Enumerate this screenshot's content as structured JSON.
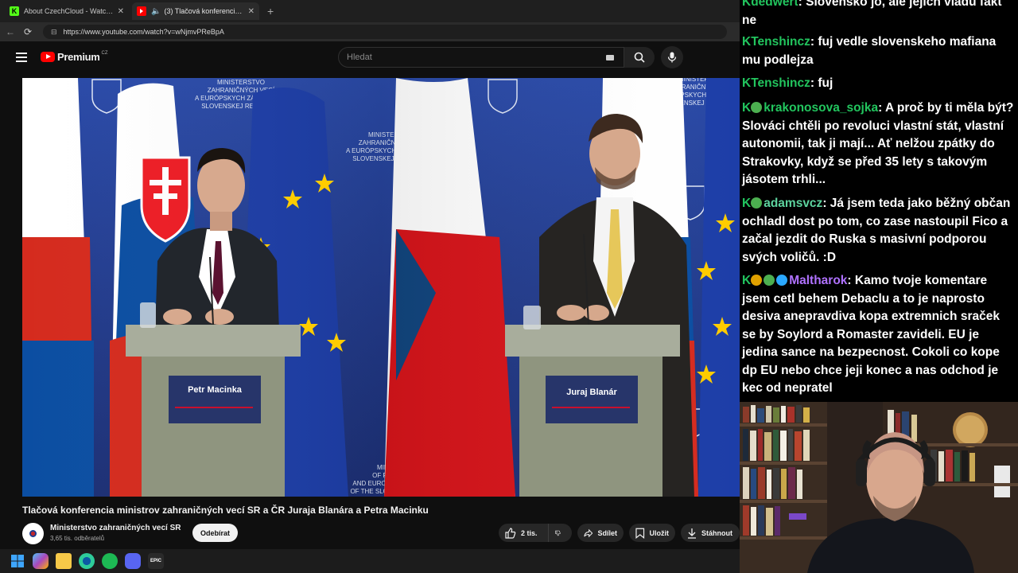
{
  "browser": {
    "tabs": [
      {
        "title": "About CzechCloud - Watch Live o",
        "close": "✕"
      },
      {
        "title": "(3) Tlačová konferencia minist",
        "close": "✕"
      }
    ],
    "new_tab": "+",
    "url": "https://www.youtube.com/watch?v=wNjmvPReBpA"
  },
  "youtube": {
    "logo": "Premium",
    "country": "CZ",
    "search_placeholder": "Hledat",
    "video": {
      "left_name": "Petr Macinka",
      "right_name": "Juraj Blanár",
      "ministry_text": [
        "MINISTERSTVO",
        "ZAHRANIČNÝCH VECÍ",
        "A EURÓPSKYCH ZÁLEŽITOSTÍ",
        "SLOVENSKEJ REPUBLIKY"
      ],
      "ministry_en": [
        "MINISTRY",
        "OF FOREIGN",
        "AND EUROPEAN AFFAIRS",
        "OF THE SLOVAK REPUBLIC"
      ]
    },
    "title": "Tlačová konferencia ministrov zahraničných vecí SR a ČR Juraja Blanára a Petra Macinku",
    "channel": "Ministerstvo zahraničných vecí SR",
    "subscribers": "3,65 tis. odběratelů",
    "subscribe": "Odebírat",
    "likes": "2 tis.",
    "share": "Sdílet",
    "save": "Uložit",
    "download": "Stáhnout"
  },
  "chat": [
    {
      "user": "dedwert",
      "user_color": "#22c55e",
      "badges": [],
      "text": "Slovensko jo, ale jejich vládu fakt ne"
    },
    {
      "user": "Tenshincz",
      "user_color": "#22c55e",
      "badges": [],
      "text": "fuj vedle slovenskeho mafiana mu podlejza"
    },
    {
      "user": "Tenshincz",
      "user_color": "#22c55e",
      "badges": [],
      "text": "fuj"
    },
    {
      "user": "krakonosova_sojka",
      "user_color": "#22c55e",
      "badges": [
        "#4caf50"
      ],
      "text": "A proč by ti měla být? Slováci chtěli po revoluci vlastní stát, vlastní autonomii, tak ji mají... Ať nelžou zpátky do Strakovky, když se před 35 lety s takovým jásotem trhli..."
    },
    {
      "user": "adamsvcz",
      "user_color": "#5dd39e",
      "badges": [
        "#4caf50"
      ],
      "text": "Já jsem teda jako běžný občan ochladl dost po tom, co zase nastoupil Fico a začal jezdit do Ruska s masivní podporou svých voličů. :D"
    },
    {
      "user": "Maltharok",
      "user_color": "#b072ff",
      "badges": [
        "#e0a100",
        "#4caf50",
        "#2aa8ff"
      ],
      "text": "Kamo tvoje komentare jsem cetl behem Debaclu a to je naprosto desiva anepravdiva kopa extremnich sraček se by Soylord a Romaster zavideli. EU je jedina sance na bezpecnost. Cokoli co kope dp EU nebo chce jeji konec a nas odchod je kec od nepratel"
    }
  ],
  "colors": {
    "youtube_red": "#ff0000",
    "kick_green": "#53fc18"
  }
}
